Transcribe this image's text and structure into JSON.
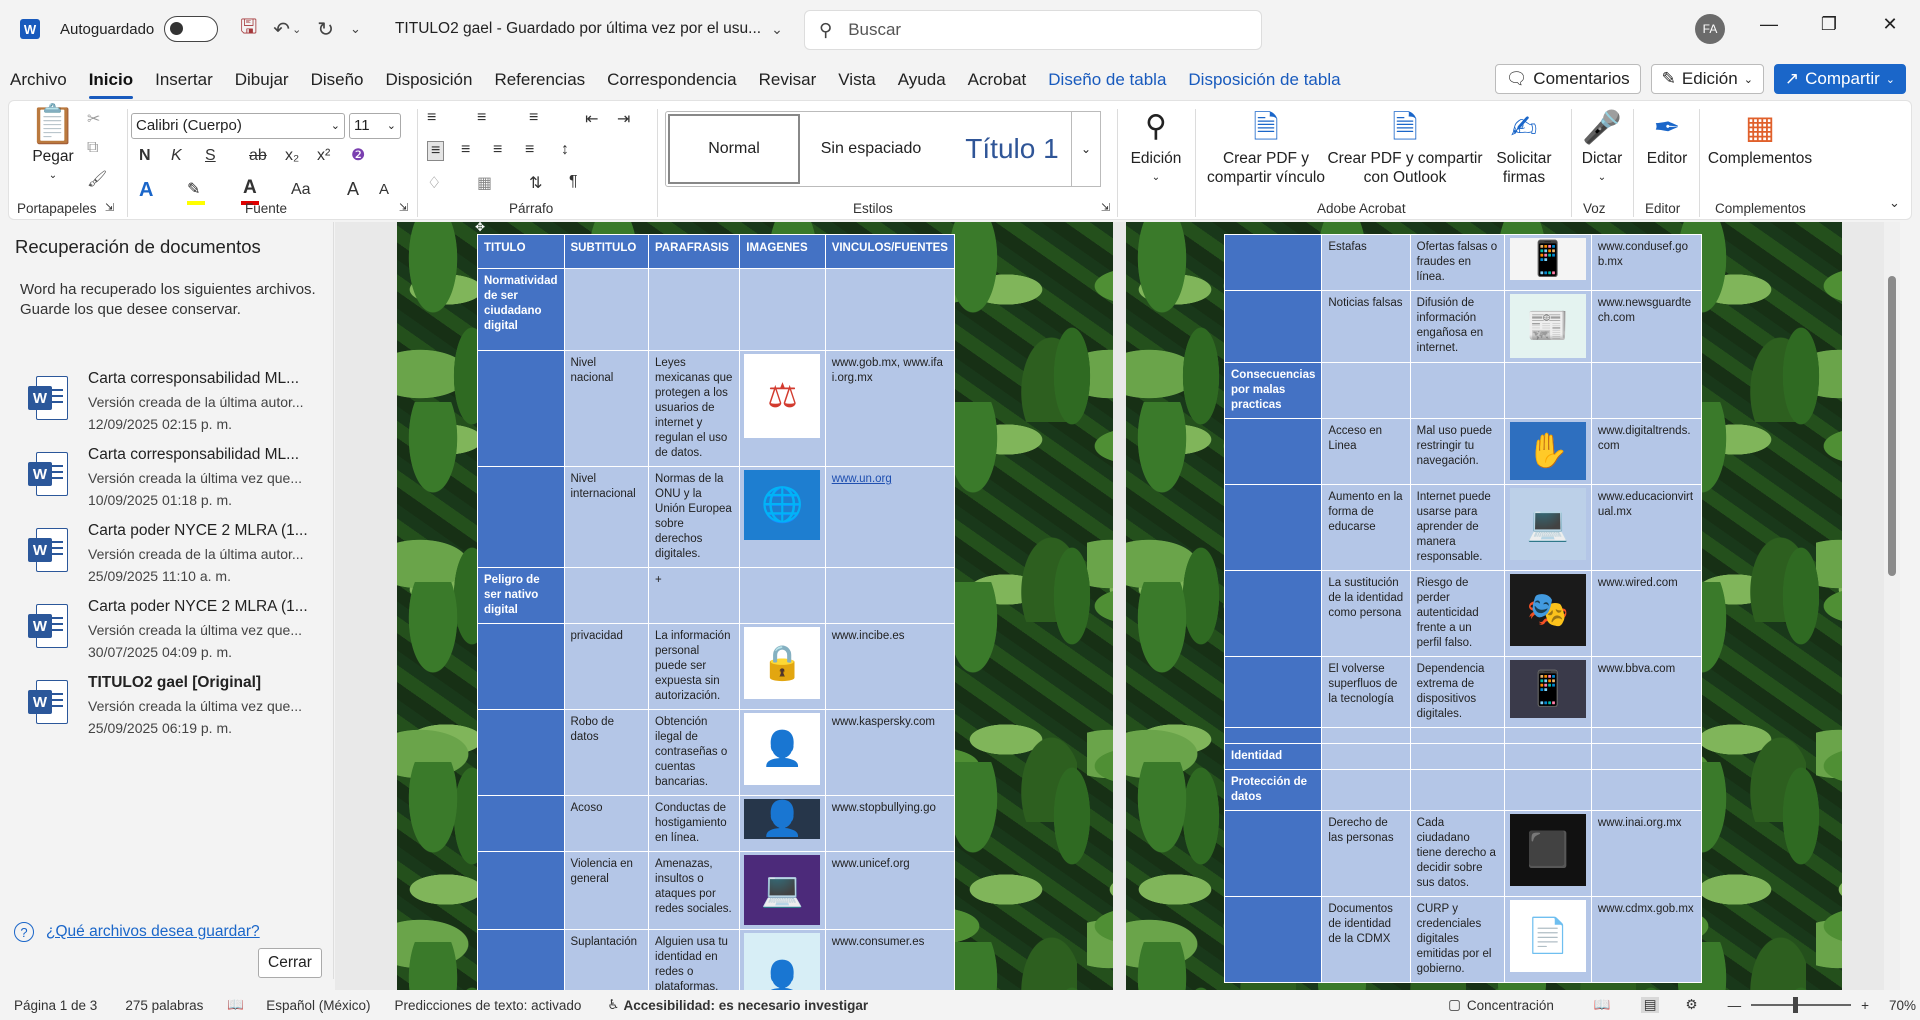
{
  "titlebar": {
    "app_icon": "W",
    "autosave_label": "Autoguardado",
    "doc_title": "TITULO2 gael  -  Guardado por última vez por el usu...",
    "search_placeholder": "Buscar",
    "avatar_initials": "FA",
    "icons": [
      "save-icon",
      "undo-icon",
      "redo-icon",
      "customize-qat-icon",
      "minimize-icon",
      "restore-icon",
      "close-icon"
    ]
  },
  "tabs": [
    "Archivo",
    "Inicio",
    "Insertar",
    "Dibujar",
    "Diseño",
    "Disposición",
    "Referencias",
    "Correspondencia",
    "Revisar",
    "Vista",
    "Ayuda",
    "Acrobat",
    "Diseño de tabla",
    "Disposición de tabla"
  ],
  "active_tab": "Inicio",
  "tab_actions": {
    "comments": "Comentarios",
    "editing": "Edición",
    "share": "Compartir"
  },
  "ribbon": {
    "clipboard": {
      "paste": "Pegar",
      "label": "Portapapeles"
    },
    "font": {
      "name": "Calibri (Cuerpo)",
      "size": "11",
      "bold": "N",
      "italic": "K",
      "underline": "S",
      "strike": "ab",
      "sub": "x₂",
      "sup": "x²",
      "case": "Aa",
      "grow": "A",
      "shrink": "A",
      "label": "Fuente"
    },
    "paragraph": {
      "label": "Párrafo"
    },
    "styles": {
      "normal": "Normal",
      "no_spacing": "Sin espaciado",
      "heading1": "Título 1",
      "label": "Estilos"
    },
    "editing_btn": "Edición",
    "acrobat": {
      "create_share": "Crear PDF y\ncompartir vínculo",
      "create_outlook": "Crear PDF y compartir\ncon Outlook",
      "request_sign": "Solicitar\nfirmas",
      "label": "Adobe Acrobat"
    },
    "voice": {
      "dictate": "Dictar",
      "label": "Voz"
    },
    "editor": {
      "btn": "Editor",
      "label": "Editor"
    },
    "addins": {
      "btn": "Complementos",
      "label": "Complementos"
    }
  },
  "recovery_pane": {
    "title": "Recuperación de documentos",
    "message": "Word ha recuperado los siguientes archivos. Guarde los que desee conservar.",
    "files": [
      {
        "name": "Carta corresponsabilidad ML...",
        "desc": "Versión creada de la última autor...",
        "date": "12/09/2025 02:15 p. m.",
        "bold": false
      },
      {
        "name": "Carta corresponsabilidad ML...",
        "desc": "Versión creada la última vez que...",
        "date": "10/09/2025 01:18 p. m.",
        "bold": false
      },
      {
        "name": "Carta poder NYCE 2  MLRA (1...",
        "desc": "Versión creada de la última autor...",
        "date": "25/09/2025 11:10 a. m.",
        "bold": false
      },
      {
        "name": "Carta poder NYCE 2  MLRA (1...",
        "desc": "Versión creada la última vez que...",
        "date": "30/07/2025 04:09 p. m.",
        "bold": false
      },
      {
        "name": "TITULO2 gael  [Original]",
        "desc": "Versión creada la última vez que...",
        "date": "25/09/2025 06:19 p. m.",
        "bold": true
      }
    ],
    "help_link": "¿Qué archivos desea guardar?",
    "close": "Cerrar"
  },
  "table1": {
    "headers": [
      "TITULO",
      "SUBTITULO",
      "PARAFRASIS",
      "IMAGENES",
      "VINCULOS/FUENTES"
    ],
    "rows": [
      {
        "titulo": "Normatividad de ser ciudadano digital",
        "subtitulo": "",
        "parafrasis": "",
        "imagen": "",
        "vinculo": ""
      },
      {
        "titulo": "",
        "subtitulo": "Nivel nacional",
        "parafrasis": "Leyes mexicanas que protegen a los usuarios de internet y regulan el uso de datos.",
        "imagen": "law-scales-icon",
        "vinculo": "www.gob.mx, www.ifai.org.mx"
      },
      {
        "titulo": "",
        "subtitulo": "Nivel internacional",
        "parafrasis": "Normas de la ONU y la Unión Europea sobre derechos digitales.",
        "imagen": "onu-logo",
        "vinculo": "www.un.org"
      },
      {
        "titulo": "Peligro de ser nativo digital",
        "subtitulo": "",
        "parafrasis": "+",
        "imagen": "",
        "vinculo": ""
      },
      {
        "titulo": "",
        "subtitulo": "privacidad",
        "parafrasis": "La información personal puede ser expuesta sin autorización.",
        "imagen": "padlock-icon",
        "vinculo": "www.incibe.es"
      },
      {
        "titulo": "",
        "subtitulo": "Robo de datos",
        "parafrasis": "Obtención ilegal de contraseñas o cuentas bancarias.",
        "imagen": "hacker-icon",
        "vinculo": "www.kaspersky.com"
      },
      {
        "titulo": "",
        "subtitulo": "Acoso",
        "parafrasis": "Conductas de hostigamiento en línea.",
        "imagen": "dark-photo",
        "vinculo": "www.stopbullying.go"
      },
      {
        "titulo": "",
        "subtitulo": "Violencia en general",
        "parafrasis": "Amenazas, insultos o ataques por redes sociales.",
        "imagen": "neon-devices-illustration",
        "vinculo": "www.unicef.org"
      },
      {
        "titulo": "",
        "subtitulo": "Suplantación",
        "parafrasis": "Alguien usa tu identidad en redes o plataformas.",
        "imagen": "mask-figure-illustration",
        "vinculo": "www.consumer.es"
      }
    ]
  },
  "table2": {
    "rows": [
      {
        "titulo": "",
        "subtitulo": "Estafas",
        "parafrasis": "Ofertas falsas o fraudes en línea.",
        "imagen": "phone-scam-illustration",
        "vinculo": "www.condusef.gob.mx"
      },
      {
        "titulo": "",
        "subtitulo": "Noticias falsas",
        "parafrasis": "Difusión de información engañosa en internet.",
        "imagen": "fake-news-illustration",
        "vinculo": "www.newsguardtech.com"
      },
      {
        "titulo": "Consecuencias por malas practicas",
        "subtitulo": "",
        "parafrasis": "",
        "imagen": "",
        "vinculo": ""
      },
      {
        "titulo": "",
        "subtitulo": "Acceso en Linea",
        "parafrasis": "Mal uso puede restringir tu navegación.",
        "imagen": "hands-network-photo",
        "vinculo": "www.digitaltrends.com"
      },
      {
        "titulo": "",
        "subtitulo": "Aumento en la forma de educarse",
        "parafrasis": "Internet puede usarse para aprender de manera responsable.",
        "imagen": "students-laptop-photo",
        "vinculo": "www.educacionvirtual.mx"
      },
      {
        "titulo": "",
        "subtitulo": "La sustitución de la identidad como persona",
        "parafrasis": "Riesgo de perder autenticidad frente a un perfil falso.",
        "imagen": "mask-person-photo",
        "vinculo": "www.wired.com"
      },
      {
        "titulo": "",
        "subtitulo": "El volverse superfluos de la tecnología",
        "parafrasis": "Dependencia extrema de dispositivos digitales.",
        "imagen": "devices-circle-photo",
        "vinculo": "www.bbva.com"
      },
      {
        "titulo": "",
        "subtitulo": "",
        "parafrasis": "",
        "imagen": "",
        "vinculo": ""
      },
      {
        "titulo": "Identidad",
        "subtitulo": "",
        "parafrasis": "",
        "imagen": "",
        "vinculo": ""
      },
      {
        "titulo": "Protección de datos",
        "subtitulo": "",
        "parafrasis": "",
        "imagen": "",
        "vinculo": ""
      },
      {
        "titulo": "",
        "subtitulo": "Derecho de las personas",
        "parafrasis": "Cada ciudadano tiene derecho a decidir sobre sus datos.",
        "imagen": "data-cube-illustration",
        "vinculo": "www.inai.org.mx"
      },
      {
        "titulo": "",
        "subtitulo": "Documentos de identidad de la CDMX",
        "parafrasis": "CURP y credenciales digitales emitidas por el gobierno.",
        "imagen": "documents-photo",
        "vinculo": "www.cdmx.gob.mx"
      }
    ]
  },
  "statusbar": {
    "page": "Página 1 de 3",
    "words": "275 palabras",
    "language": "Español (México)",
    "predictions": "Predicciones de texto: activado",
    "accessibility": "Accesibilidad: es necesario investigar",
    "focus": "Concentración",
    "zoom": "70%"
  }
}
